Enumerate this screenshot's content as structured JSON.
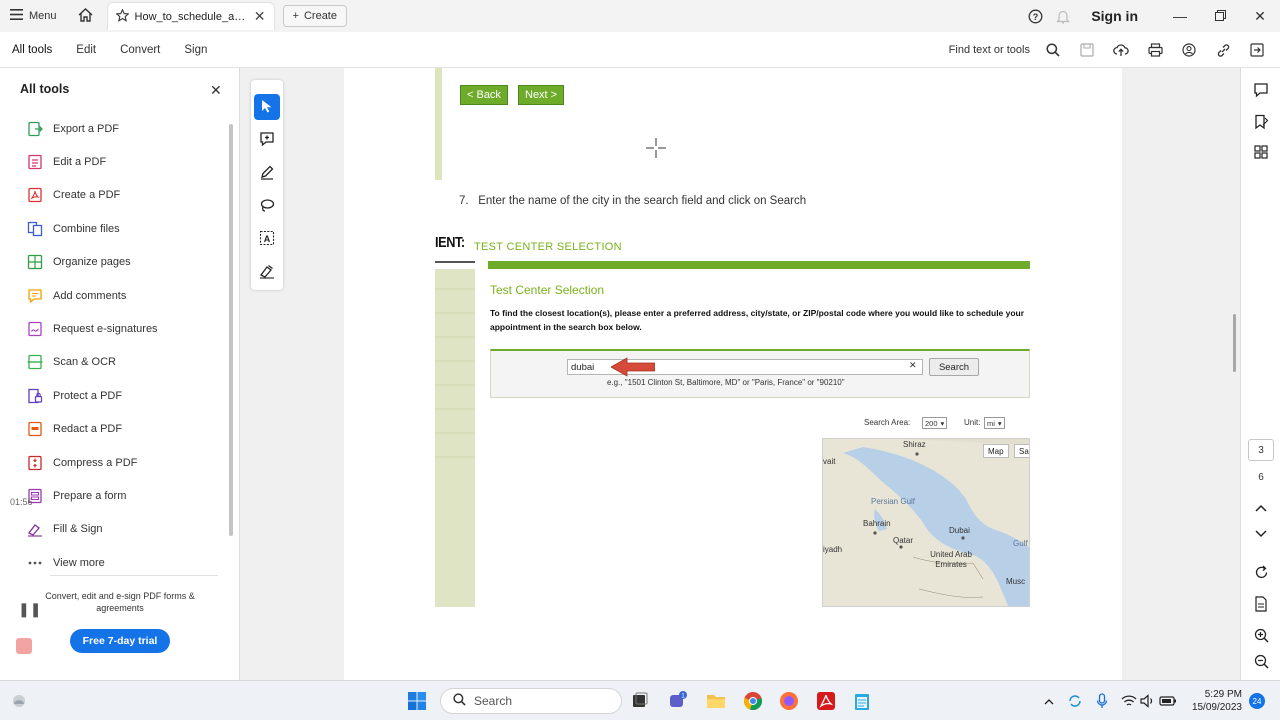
{
  "titlebar": {
    "menu_label": "Menu",
    "tab_title": "How_to_schedule_an_e...",
    "create_label": "Create",
    "sign_in": "Sign in"
  },
  "menubar": {
    "items": [
      "All tools",
      "Edit",
      "Convert",
      "Sign"
    ],
    "find_label": "Find text or tools"
  },
  "left_panel": {
    "title": "All tools",
    "tools": [
      {
        "label": "Export a PDF",
        "icon": "export-pdf-icon",
        "color": "#2f9e5a"
      },
      {
        "label": "Edit a PDF",
        "icon": "edit-pdf-icon",
        "color": "#d6336c"
      },
      {
        "label": "Create a PDF",
        "icon": "create-pdf-icon",
        "color": "#e03131"
      },
      {
        "label": "Combine files",
        "icon": "combine-files-icon",
        "color": "#3b5bdb"
      },
      {
        "label": "Organize pages",
        "icon": "organize-pages-icon",
        "color": "#2f9e44"
      },
      {
        "label": "Add comments",
        "icon": "add-comments-icon",
        "color": "#f59f00"
      },
      {
        "label": "Request e-signatures",
        "icon": "request-esignatures-icon",
        "color": "#ae3ec9"
      },
      {
        "label": "Scan & OCR",
        "icon": "scan-ocr-icon",
        "color": "#37b24d"
      },
      {
        "label": "Protect a PDF",
        "icon": "protect-pdf-icon",
        "color": "#5f3dc4"
      },
      {
        "label": "Redact a PDF",
        "icon": "redact-pdf-icon",
        "color": "#e8590c"
      },
      {
        "label": "Compress a PDF",
        "icon": "compress-pdf-icon",
        "color": "#c92a2a"
      },
      {
        "label": "Prepare a form",
        "icon": "prepare-form-icon",
        "color": "#9c36b5"
      },
      {
        "label": "Fill & Sign",
        "icon": "fill-sign-icon",
        "color": "#862e9c"
      },
      {
        "label": "View more",
        "icon": "view-more-icon",
        "color": "#555555"
      }
    ],
    "promo_text": "Convert, edit and e-sign PDF forms & agreements",
    "trial_button": "Free 7-day trial",
    "recorder_time": "01:56"
  },
  "document": {
    "back_button": "< Back",
    "next_button": "Next >",
    "step_number": "7.",
    "step_text": "Enter the name of the city in the search field and click on Search",
    "header_fragment": "IENT:",
    "header_section": "TEST CENTER SELECTION",
    "panel_title": "Test Center Selection",
    "instructions": "To find the closest location(s), please enter a preferred address, city/state, or ZIP/postal code where you would like to schedule your appointment in the search box below.",
    "search_value": "dubai",
    "search_button": "Search",
    "search_example": "e.g., \"1501 Clinton St, Baltimore, MD\" or \"Paris, France\" or \"90210\"",
    "search_area_label": "Search Area:",
    "search_area_value": "200",
    "unit_label": "Unit:",
    "unit_value": "mi",
    "map_buttons": [
      "Map",
      "Sat"
    ],
    "map_labels": [
      "Shiraz",
      "vait",
      "Persian Gulf",
      "Bahrain",
      "Qatar",
      "Dubai",
      "United Arab Emirates",
      "iyadh",
      "Gulf",
      "Musc"
    ]
  },
  "right_rail": {
    "pages": [
      "3",
      "6"
    ]
  },
  "taskbar": {
    "search_label": "Search",
    "time": "5:29 PM",
    "date": "15/09/2023",
    "notification_count": "24"
  },
  "colors": {
    "accent": "#1473e6",
    "pearson_green": "#6eab2a",
    "arrow_red": "#d64a3a"
  }
}
